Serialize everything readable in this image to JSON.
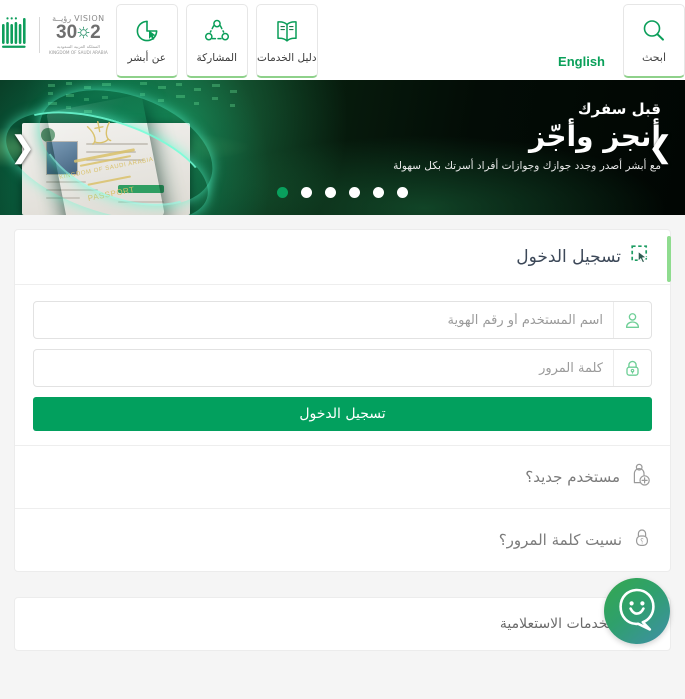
{
  "header": {
    "search_button": {
      "label": "ابحث",
      "icon": "search-icon"
    },
    "language_link": "English",
    "nav_buttons": [
      {
        "label": "دليل الخدمات",
        "icon": "book-icon"
      },
      {
        "label": "المشاركة",
        "icon": "share-network-icon"
      },
      {
        "label": "عن أبشر",
        "icon": "cursor-pie-icon"
      }
    ],
    "logos": {
      "vision_word": "VISION",
      "vision_word_ar": "رؤيــة",
      "vision_number": "2030",
      "vision_sub_ar": "المملكة العربية السعودية",
      "vision_sub_en": "KINGDOM OF SAUDI ARABIA",
      "absher_logo": "absher-wordmark"
    }
  },
  "banner": {
    "kicker": "قبل سفرك",
    "title": "أنجز وأجّز",
    "subtitle": "مع أبشر أصدر وجدد جوازك وجوازات أفراد أسرتك بكل سهولة",
    "prev_arrow": "❮",
    "next_arrow": "❯",
    "dots_total": 6,
    "active_dot_index": 5
  },
  "login_card": {
    "title": "تسجيل الدخول",
    "title_icon": "cursor-select-icon",
    "username_field": {
      "placeholder": "اسم المستخدم أو رقم الهوية",
      "value": "",
      "icon": "user-icon"
    },
    "password_field": {
      "placeholder": "كلمة المرور",
      "value": "",
      "icon": "lock-icon"
    },
    "submit_label": "تسجيل الدخول",
    "links": [
      {
        "label": "مستخدم جديد؟",
        "icon": "user-add-icon"
      },
      {
        "label": "نسيت كلمة المرور؟",
        "icon": "lock-question-icon"
      }
    ]
  },
  "info_card": {
    "label": "الخدمات الاستعلامية",
    "icon": "browser-search-icon"
  },
  "chatbot": {
    "icon": "chatbot-smiley-icon"
  },
  "colors": {
    "brand_green": "#02a05e",
    "accent_light_green": "#8fdc8f",
    "link_green": "#0aa05a",
    "title_slate": "#3c4858",
    "page_bg": "#f5f5f5"
  }
}
